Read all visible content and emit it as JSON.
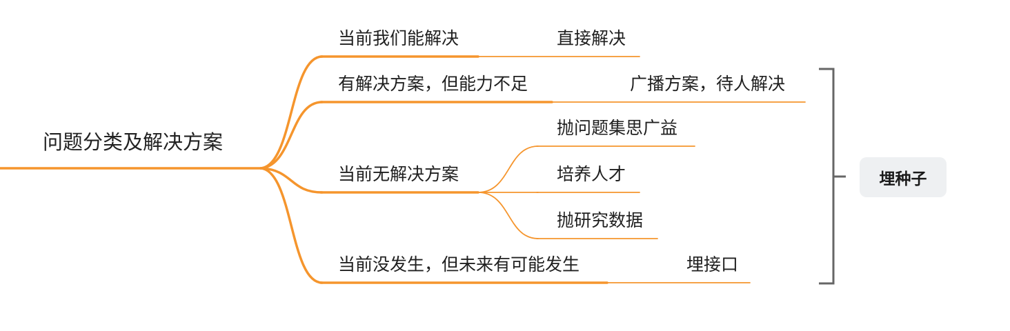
{
  "colors": {
    "branch": "#F5952D",
    "bracket": "#666666",
    "tag_background": "#EEF0F2"
  },
  "root": {
    "label": "问题分类及解决方案"
  },
  "branches": [
    {
      "label": "当前我们能解决",
      "children": [
        "直接解决"
      ]
    },
    {
      "label": "有解决方案，但能力不足",
      "children": [
        "广播方案，待人解决"
      ]
    },
    {
      "label": "当前无解决方案",
      "children": [
        "抛问题集思广益",
        "培养人才",
        "抛研究数据"
      ]
    },
    {
      "label": "当前没发生，但未来有可能发生",
      "children": [
        "埋接口"
      ]
    }
  ],
  "summary": {
    "label": "埋种子"
  }
}
